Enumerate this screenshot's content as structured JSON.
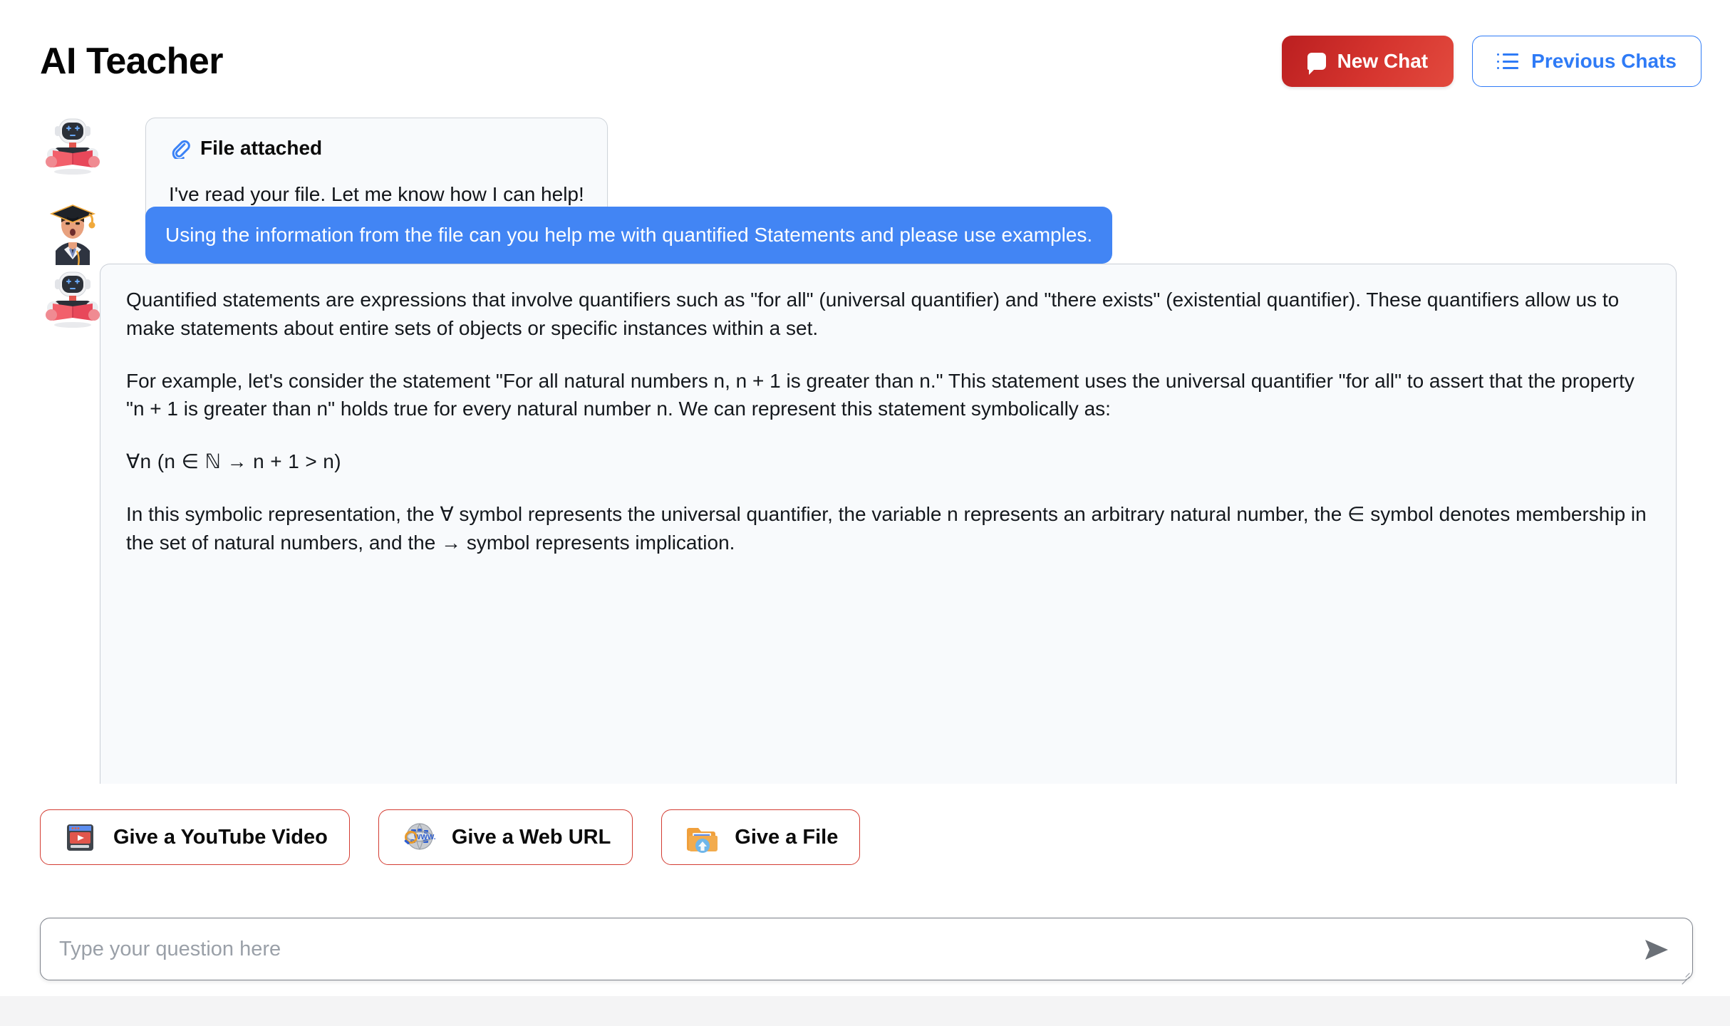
{
  "header": {
    "app_title": "AI Teacher",
    "new_chat_label": "New Chat",
    "new_chat_icon": "speech-bubble-icon",
    "previous_chats_label": "Previous Chats",
    "previous_chats_icon": "list-icon",
    "new_chat_color": "#cc2b28",
    "previous_chats_color": "#2f7bf6"
  },
  "messages": [
    {
      "role": "assistant",
      "avatar_icon": "robot-reading-book-avatar",
      "attachment_label": "File attached",
      "attachment_icon": "paperclip-icon",
      "text": "I've read your file. Let me know how I can help!"
    },
    {
      "role": "user",
      "avatar_icon": "graduate-student-avatar",
      "text": "Using the information from the file can you help me with quantified Statements and please use examples.",
      "bubble_color": "#4285f4"
    },
    {
      "role": "assistant",
      "avatar_icon": "robot-reading-book-avatar",
      "paragraphs": [
        "Quantified statements are expressions that involve quantifiers such as \"for all\" (universal quantifier) and \"there exists\" (existential quantifier). These quantifiers allow us to make statements about entire sets of objects or specific instances within a set.",
        "For example, let's consider the statement \"For all natural numbers n, n + 1 is greater than n.\" This statement uses the universal quantifier \"for all\" to assert that the property \"n + 1 is greater than n\" holds true for every natural number n. We can represent this statement symbolically as:",
        "∀n (n ∈ ℕ → n + 1 > n)",
        "In this symbolic representation, the ∀ symbol represents the universal quantifier, the variable n represents an arbitrary natural number, the ∈ symbol denotes membership in the set of natural numbers, and the → symbol represents implication."
      ]
    }
  ],
  "source_buttons": [
    {
      "label": "Give a YouTube Video",
      "icon": "youtube-video-icon"
    },
    {
      "label": "Give a Web URL",
      "icon": "web-globe-icon"
    },
    {
      "label": "Give a File",
      "icon": "folder-upload-icon"
    }
  ],
  "composer": {
    "placeholder": "Type your question here",
    "value": "",
    "send_icon": "send-arrow-icon",
    "resize_handle": "resize-grip"
  }
}
